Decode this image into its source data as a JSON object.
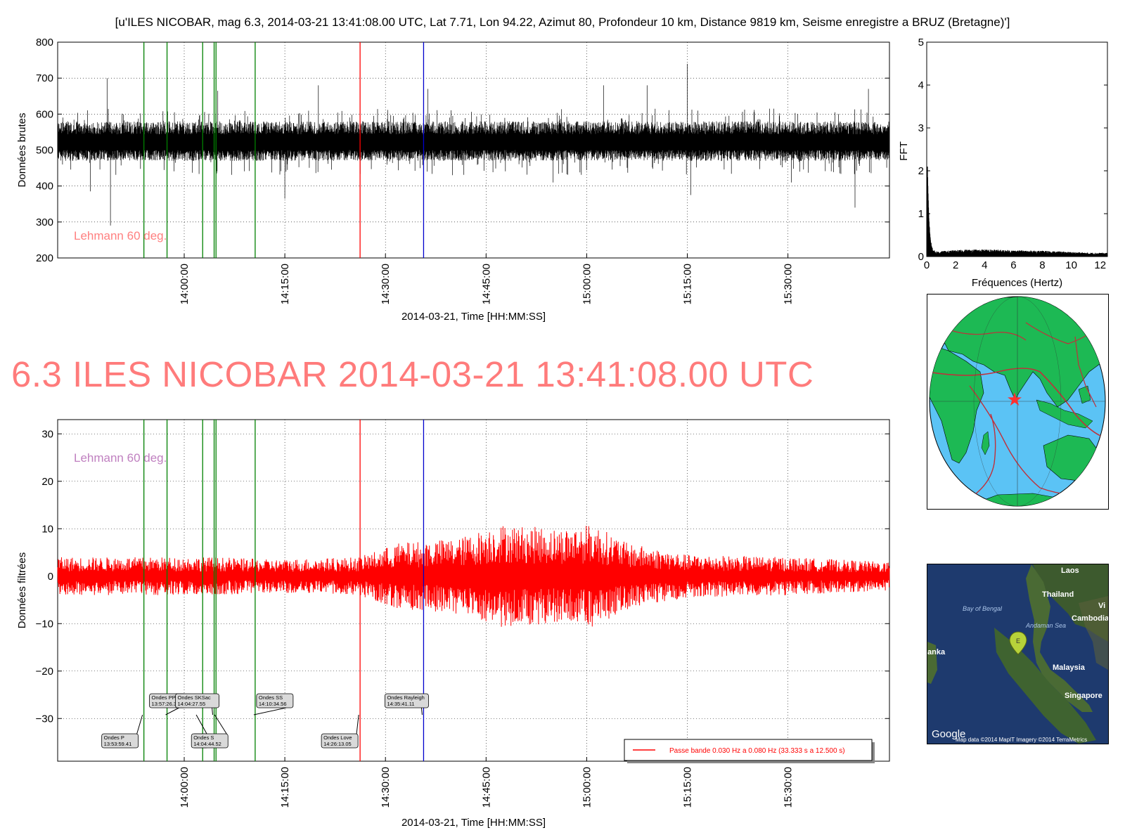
{
  "header": {
    "title": "[u'ILES NICOBAR, mag 6.3, 2014-03-21 13:41:08.00 UTC, Lat 7.71, Lon 94.22, Azimut  80, Profondeur 10 km, Distance  9819 km, Seisme enregistre a BRUZ (Bretagne)']",
    "big_title": "6.3 ILES NICOBAR 2014-03-21 13:41:08.00 UTC"
  },
  "colors": {
    "raw_trace": "#000000",
    "filtered_trace": "#ff0000",
    "phase_line": "#008000",
    "love_line": "#ff0000",
    "rayleigh_line": "#0000cc",
    "lehmann_top": "#ff8080",
    "lehmann_bottom": "#c080c0",
    "big_title": "#ff7b7b"
  },
  "chart_data": [
    {
      "id": "raw",
      "type": "line",
      "xlabel": "2014-03-21, Time [HH:MM:SS]",
      "ylabel": "Données brutes",
      "xlim": [
        "13:41:08",
        "15:45:08"
      ],
      "ylim": [
        200,
        800
      ],
      "yticks": [
        200,
        300,
        400,
        500,
        600,
        700,
        800
      ],
      "xticks": [
        "14:00:00",
        "14:15:00",
        "14:30:00",
        "14:45:00",
        "15:00:00",
        "15:15:00",
        "15:30:00"
      ],
      "grid": true,
      "baseline": 520,
      "noise_band": [
        470,
        580
      ],
      "annotation": "Lehmann 60 deg.",
      "spikes": [
        {
          "t": "13:48:30",
          "v": 700
        },
        {
          "t": "13:49:00",
          "v": 290
        },
        {
          "t": "13:46:00",
          "v": 385
        },
        {
          "t": "14:05:00",
          "v": 665
        },
        {
          "t": "14:20:00",
          "v": 680
        },
        {
          "t": "14:15:00",
          "v": 365
        },
        {
          "t": "14:36:20",
          "v": 670
        },
        {
          "t": "14:40:00",
          "v": 430
        },
        {
          "t": "14:55:00",
          "v": 410
        },
        {
          "t": "15:02:30",
          "v": 680
        },
        {
          "t": "15:09:00",
          "v": 680
        },
        {
          "t": "15:15:00",
          "v": 740
        },
        {
          "t": "15:15:30",
          "v": 375
        },
        {
          "t": "15:30:30",
          "v": 410
        },
        {
          "t": "15:40:00",
          "v": 340
        },
        {
          "t": "15:42:00",
          "v": 670
        }
      ],
      "series": []
    },
    {
      "id": "fft",
      "type": "line",
      "xlabel": "Fréquences (Hertz)",
      "ylabel": "FFT",
      "xlim": [
        0,
        12.5
      ],
      "ylim": [
        0,
        5
      ],
      "xticks": [
        0,
        2,
        4,
        6,
        8,
        10,
        12
      ],
      "yticks": [
        0,
        1,
        2,
        3,
        4,
        5
      ],
      "peak": {
        "x": 0.05,
        "y": 2.1
      },
      "floor_level": 0.1
    },
    {
      "id": "filtered",
      "type": "line",
      "xlabel": "2014-03-21, Time [HH:MM:SS]",
      "ylabel": "Données filtrées",
      "xlim": [
        "13:41:08",
        "15:45:08"
      ],
      "ylim": [
        -39,
        33
      ],
      "yticks": [
        -30,
        -20,
        -10,
        0,
        10,
        20,
        30
      ],
      "xticks": [
        "14:00:00",
        "14:15:00",
        "14:30:00",
        "14:45:00",
        "15:00:00",
        "15:15:00",
        "15:30:00"
      ],
      "grid": true,
      "annotation": "Lehmann 60 deg.",
      "legend_position": "lower-right",
      "envelope": [
        {
          "t": "13:41:08",
          "a": 4
        },
        {
          "t": "14:05:00",
          "a": 4
        },
        {
          "t": "14:13:00",
          "a": 3.5
        },
        {
          "t": "14:26:00",
          "a": 4
        },
        {
          "t": "14:32:00",
          "a": 7
        },
        {
          "t": "14:41:00",
          "a": 8
        },
        {
          "t": "14:47:00",
          "a": 11
        },
        {
          "t": "14:56:00",
          "a": 10
        },
        {
          "t": "15:01:00",
          "a": 11
        },
        {
          "t": "15:06:00",
          "a": 7
        },
        {
          "t": "15:15:00",
          "a": 4.5
        },
        {
          "t": "15:30:00",
          "a": 4
        },
        {
          "t": "15:45:08",
          "a": 3
        }
      ],
      "series": [
        {
          "name": "Passe bande 0.030 Hz a 0.080 Hz (33.333 s a 12.500 s)"
        }
      ]
    }
  ],
  "phases": [
    {
      "id": "P",
      "label": "Ondes P",
      "time": "13:53:59.41",
      "color": "#008000"
    },
    {
      "id": "PP",
      "label": "Ondes PP",
      "time": "13:57:26.31",
      "color": "#008000"
    },
    {
      "id": "S",
      "label": "Ondes S",
      "time": "14:04:44.52",
      "color": "#008000"
    },
    {
      "id": "SKSac",
      "label": "Ondes SKSac",
      "time": "14:04:27.55",
      "color": "#008000"
    },
    {
      "id": "Sc",
      "label": "Ondes S",
      "time": "14:02:45.00",
      "color": "#008000"
    },
    {
      "id": "SS",
      "label": "Ondes SS",
      "time": "14:10:34.56",
      "color": "#008000"
    },
    {
      "id": "Love",
      "label": "Ondes Love",
      "time": "14:26:13.05",
      "color": "#ff0000"
    },
    {
      "id": "Rayleigh",
      "label": "Ondes Rayleigh",
      "time": "14:35:41.11",
      "color": "#0000cc"
    }
  ],
  "phase_boxes": [
    {
      "label": "Ondes P",
      "time": "13:53:59.41"
    },
    {
      "label": "Ondes PP",
      "time": "13:57:26.31"
    },
    {
      "label": "Onde",
      "time": "14:02"
    },
    {
      "label": "Ondes S",
      "time": "14:04:44.52"
    },
    {
      "label": "Ondes SKSac",
      "time": "14:04:27.55"
    },
    {
      "label": "Ondes SS",
      "time": "14:10:34.56"
    },
    {
      "label": "Ondes Love",
      "time": "14:26:13.05"
    },
    {
      "label": "Ondes Rayleigh",
      "time": "14:35:41.11"
    }
  ],
  "satellite_map": {
    "labels": [
      "Laos",
      "Thailand",
      "Vi",
      "Cambodia",
      "Bay of Bengal",
      "Andaman Sea",
      "Malaysia",
      "Singapore",
      "anka"
    ],
    "marker_letter": "E",
    "logo": "Google",
    "credits": "Map data ©2014 MapIT  Imagery ©2014 TerraMetrics"
  },
  "globe": {
    "marker": "red-star"
  }
}
